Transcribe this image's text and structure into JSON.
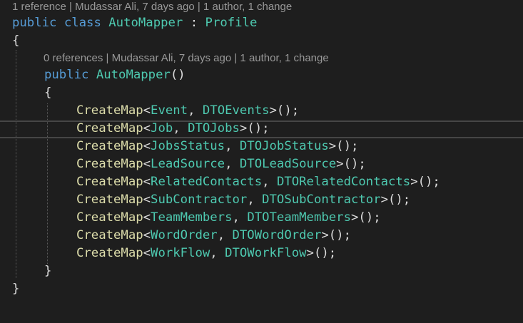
{
  "code_lens": {
    "class_lens": "1 reference | Mudassar Ali, 7 days ago | 1 author, 1 change",
    "ctor_lens": "0 references | Mudassar Ali, 7 days ago | 1 author, 1 change"
  },
  "class_decl": {
    "kw_public": "public",
    "kw_class": "class",
    "name": "AutoMapper",
    "sep": " : ",
    "base": "Profile"
  },
  "ctor_decl": {
    "kw_public": "public",
    "name": "AutoMapper",
    "parens": "()"
  },
  "braces": {
    "open": "{",
    "close": "}"
  },
  "statements": [
    {
      "method": "CreateMap",
      "src": "Event",
      "dst": "DTOEvents"
    },
    {
      "method": "CreateMap",
      "src": "Job",
      "dst": "DTOJobs"
    },
    {
      "method": "CreateMap",
      "src": "JobsStatus",
      "dst": "DTOJobStatus"
    },
    {
      "method": "CreateMap",
      "src": "LeadSource",
      "dst": "DTOLeadSource"
    },
    {
      "method": "CreateMap",
      "src": "RelatedContacts",
      "dst": "DTORelatedContacts"
    },
    {
      "method": "CreateMap",
      "src": "SubContractor",
      "dst": "DTOSubContractor"
    },
    {
      "method": "CreateMap",
      "src": "TeamMembers",
      "dst": "DTOTeamMembers"
    },
    {
      "method": "CreateMap",
      "src": "WordOrder",
      "dst": "DTOWordOrder"
    },
    {
      "method": "CreateMap",
      "src": "WorkFlow",
      "dst": "DTOWorkFlow"
    }
  ],
  "tokens": {
    "lt": "<",
    "comma": ", ",
    "gt_call": ">();"
  },
  "colors": {
    "background": "#1e1e1e",
    "keyword": "#569cd6",
    "type": "#4ec9b0",
    "method": "#dcdcaa",
    "punctuation": "#dcdcdc",
    "codelens": "#999999"
  }
}
